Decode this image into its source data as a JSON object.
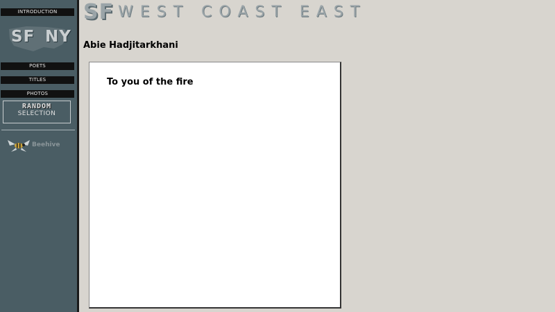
{
  "nav": {
    "introduction": "INTRODUCTION",
    "poets": "POETS",
    "titles": "TITLES",
    "photos": "PHOTOS"
  },
  "logo": {
    "left": "SF",
    "right": "NY"
  },
  "random": {
    "top": "RANDOM",
    "bottom": "SELECTION"
  },
  "beehive": {
    "label": "Beehive"
  },
  "header": {
    "sf": "SF",
    "title": "WEST COAST EAST"
  },
  "author": "Abie Hadjitarkhani",
  "poem": {
    "title": "To you of the fire"
  },
  "colors": {
    "sidebar": "#4a5d64",
    "page": "#d8d5cf",
    "nav_bar": "#111111",
    "title": "#9aa4a8"
  }
}
